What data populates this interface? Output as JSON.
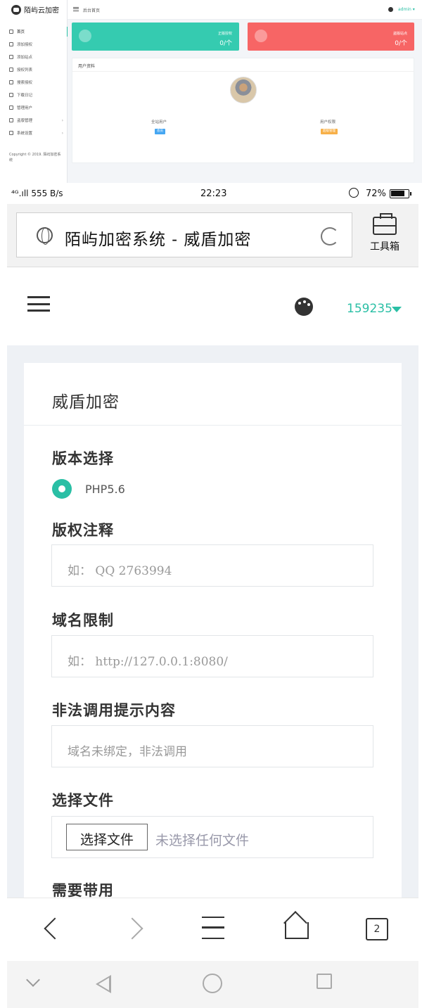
{
  "admin": {
    "logo_text": "陌屿云加密",
    "menu": [
      {
        "label": "首页",
        "icon": "home-icon",
        "active": true
      },
      {
        "label": "添加授权",
        "icon": "cloud-icon"
      },
      {
        "label": "添加站点",
        "icon": "site-icon"
      },
      {
        "label": "授权列表",
        "icon": "list-icon"
      },
      {
        "label": "搜索授权",
        "icon": "search-icon"
      },
      {
        "label": "下载日记",
        "icon": "download-icon"
      },
      {
        "label": "管理用户",
        "icon": "users-icon"
      },
      {
        "label": "盗版管理",
        "icon": "file-icon",
        "caret": "›"
      },
      {
        "label": "系统设置",
        "icon": "settings-icon",
        "caret": "›"
      }
    ],
    "copyright": "Copyright © 2019. 陌屿加密系统",
    "topbar_title": "后台首页",
    "topbar_user": "admin ▾",
    "cards": [
      {
        "label": "正版授权",
        "value": "0/个",
        "color": "#35cbb0"
      },
      {
        "label": "盗版站点",
        "value": "0/个",
        "color": "#f76565"
      }
    ],
    "profile_title": "用户资料",
    "stat_left_label": "全站用户",
    "stat_left_badge": "会员",
    "stat_right_label": "用户权限",
    "stat_right_badge": "超级管理"
  },
  "status": {
    "signal": "⁴ᴳ.ıll",
    "speed": "555 B/s",
    "time": "22:23",
    "battery": "72%"
  },
  "browser": {
    "title": "陌屿加密系统 - 威盾加密",
    "toolbox_label": "工具箱"
  },
  "app": {
    "user_id": "159235",
    "accent": "#2abfa5",
    "card_title": "威盾加密",
    "version_label": "版本选择",
    "version_option": "PHP5.6",
    "copyright_label": "版权注释",
    "copyright_placeholder_prefix": "如：",
    "copyright_placeholder_value": "QQ 2763994",
    "domain_label": "域名限制",
    "domain_placeholder_prefix": "如：",
    "domain_placeholder_value": "http://127.0.0.1:8080/",
    "illegal_label": "非法调用提示内容",
    "illegal_placeholder": "域名未绑定，非法调用",
    "file_label": "选择文件",
    "file_button": "选择文件",
    "file_none": "未选择任何文件",
    "need_label": "需要带用"
  },
  "nav": {
    "tabs_count": "2"
  }
}
